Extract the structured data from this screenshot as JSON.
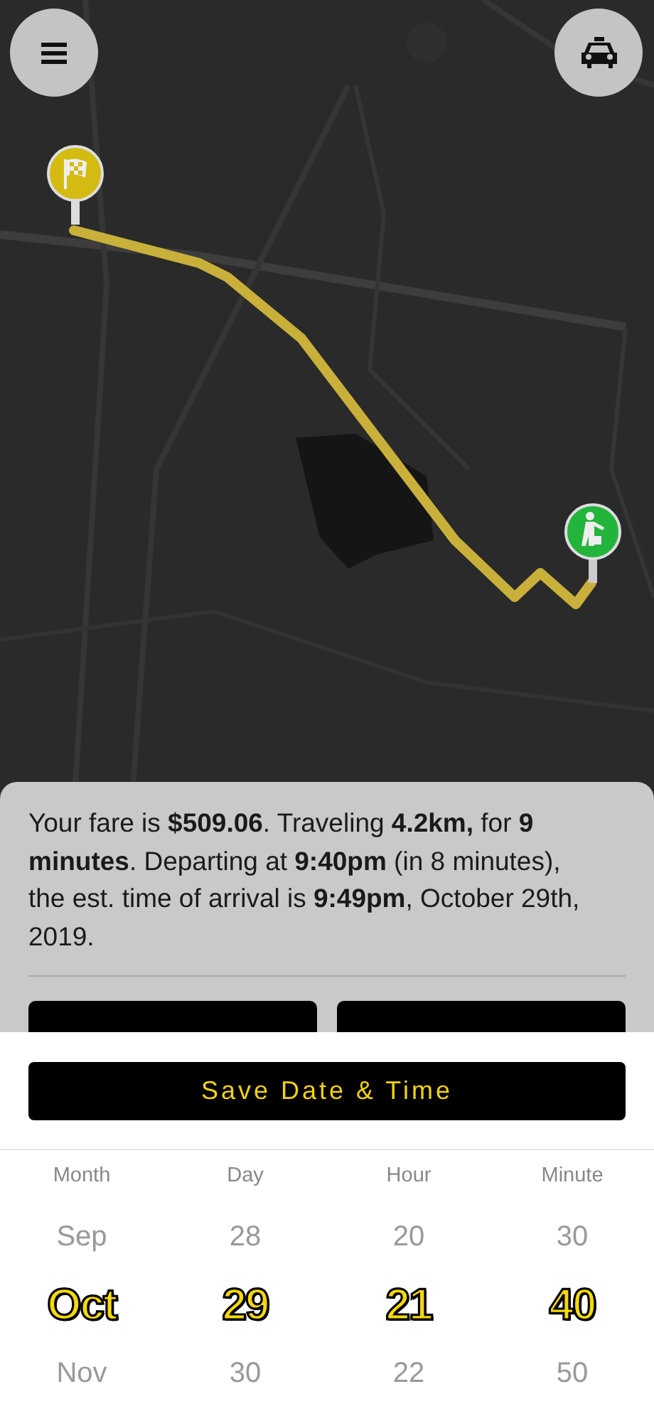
{
  "fare_summary": "Your fare is **$509.06**. Traveling **4.2km,** for **9 minutes**. Departing at **9:40pm** (in 8 minutes), the est. time of arrival is **9:49pm**, October 29th, 2019.",
  "save_button": "Save Date & Time",
  "picker": [
    {
      "label": "Month",
      "options": [
        {
          "text": "Sep",
          "selected": false
        },
        {
          "text": "Oct",
          "selected": true
        },
        {
          "text": "Nov",
          "selected": false
        }
      ]
    },
    {
      "label": "Day",
      "options": [
        {
          "text": "28",
          "selected": false
        },
        {
          "text": "29",
          "selected": true
        },
        {
          "text": "30",
          "selected": false
        }
      ]
    },
    {
      "label": "Hour",
      "options": [
        {
          "text": "20",
          "selected": false
        },
        {
          "text": "21",
          "selected": true
        },
        {
          "text": "22",
          "selected": false
        }
      ]
    },
    {
      "label": "Minute",
      "options": [
        {
          "text": "30",
          "selected": false
        },
        {
          "text": "40",
          "selected": true
        },
        {
          "text": "50",
          "selected": false
        }
      ]
    }
  ]
}
